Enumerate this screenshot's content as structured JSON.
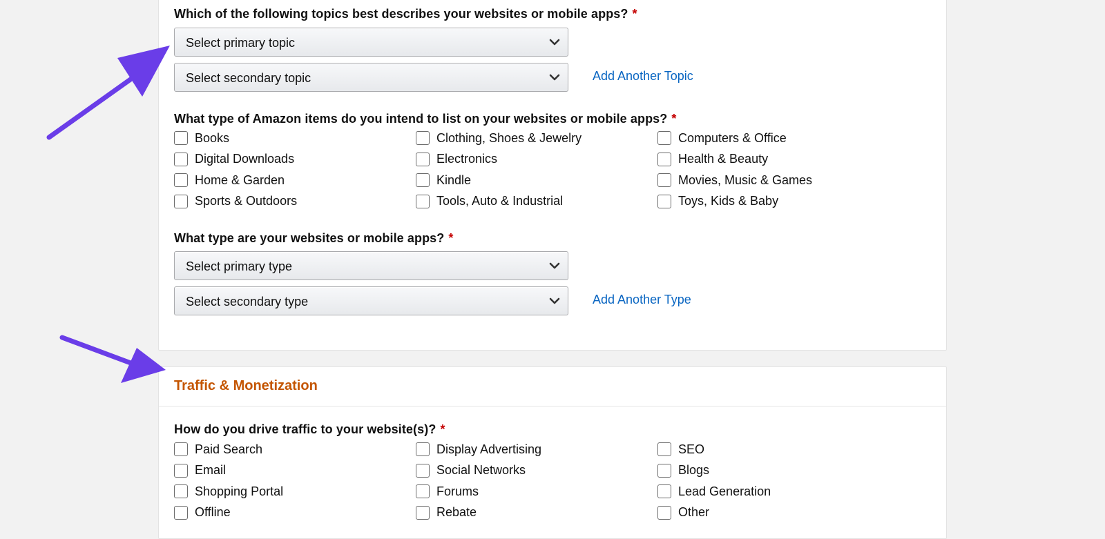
{
  "topics": {
    "question": "Which of the following topics best describes your websites or mobile apps?",
    "required_mark": "*",
    "primary_select": "Select primary topic",
    "secondary_select": "Select secondary topic",
    "add_link": "Add Another Topic"
  },
  "items": {
    "question": "What type of Amazon items do you intend to list on your websites or mobile apps?",
    "required_mark": "*",
    "options": [
      "Books",
      "Clothing, Shoes & Jewelry",
      "Computers & Office",
      "Digital Downloads",
      "Electronics",
      "Health & Beauty",
      "Home & Garden",
      "Kindle",
      "Movies, Music & Games",
      "Sports & Outdoors",
      "Tools, Auto & Industrial",
      "Toys, Kids & Baby"
    ]
  },
  "types": {
    "question": "What type are your websites or mobile apps?",
    "required_mark": "*",
    "primary_select": "Select primary type",
    "secondary_select": "Select secondary type",
    "add_link": "Add Another Type"
  },
  "traffic": {
    "section_title": "Traffic & Monetization",
    "question": "How do you drive traffic to your website(s)?",
    "required_mark": "*",
    "options": [
      "Paid Search",
      "Display Advertising",
      "SEO",
      "Email",
      "Social Networks",
      "Blogs",
      "Shopping Portal",
      "Forums",
      "Lead Generation",
      "Offline",
      "Rebate",
      "Other"
    ]
  },
  "colors": {
    "background": "#f2f2f2",
    "link": "#0a66c2",
    "section_title": "#c45500",
    "required": "#c40000",
    "annotation_arrow": "#6a3de8"
  },
  "annotations": [
    "arrow-icon",
    "arrow-icon"
  ]
}
